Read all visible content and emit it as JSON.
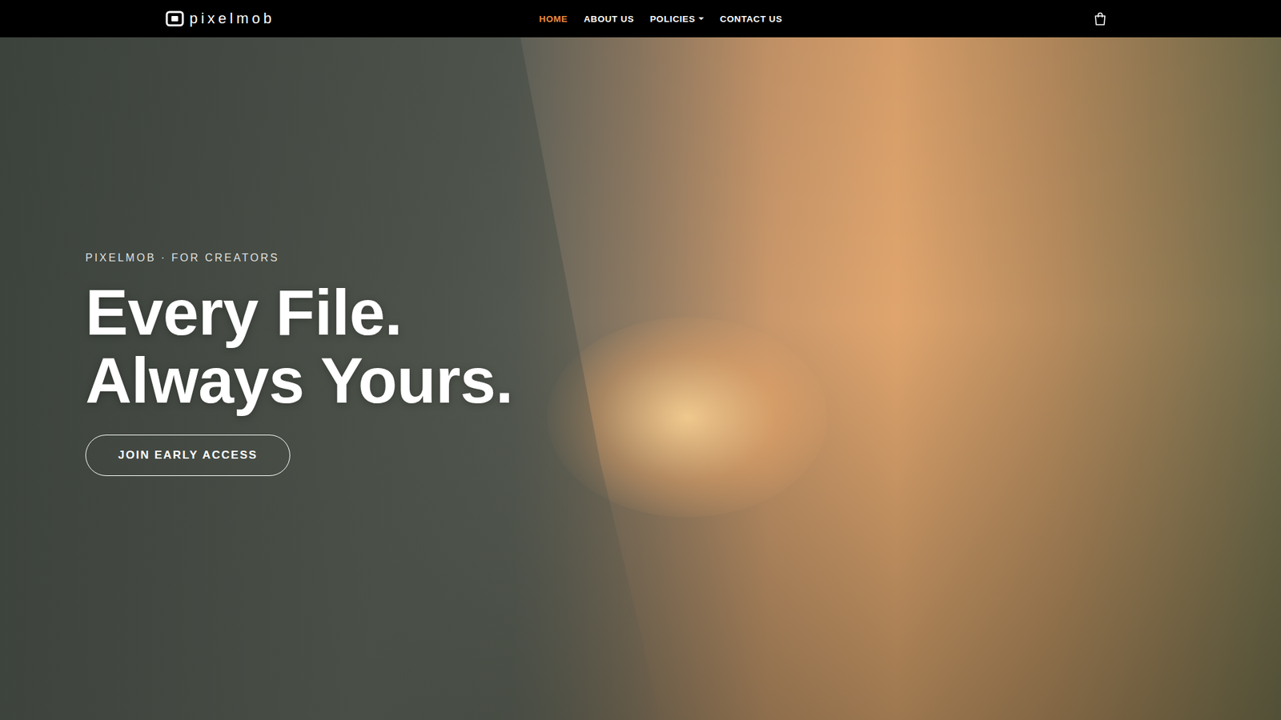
{
  "nav": {
    "logo": "pixelmob",
    "items": [
      {
        "label": "HOME",
        "selected": true,
        "dropdown": false
      },
      {
        "label": "ABOUT US",
        "selected": false,
        "dropdown": false
      },
      {
        "label": "POLICIES",
        "selected": false,
        "dropdown": true
      },
      {
        "label": "CONTACT US",
        "selected": false,
        "dropdown": false
      }
    ]
  },
  "hero": {
    "eyebrow": "PIXELMOB · FOR CREATORS",
    "headline": [
      "Every File.",
      "Always Yours."
    ],
    "button": "JOIN EARLY ACCESS"
  }
}
